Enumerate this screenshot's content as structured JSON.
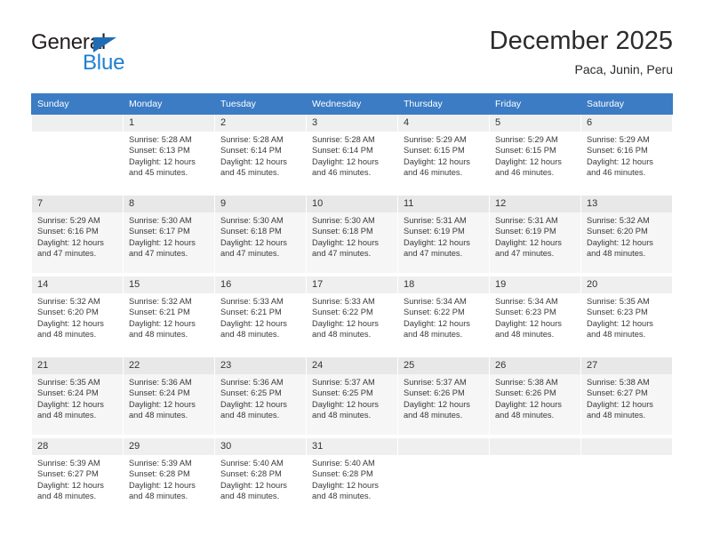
{
  "brand": {
    "name_part1": "General",
    "name_part2": "Blue",
    "triangle_color": "#1f6cb4",
    "blue_color": "#1f7fd0"
  },
  "header": {
    "title": "December 2025",
    "subtitle": "Paca, Junin, Peru"
  },
  "theme": {
    "header_bg": "#3b7cc4",
    "header_text": "#ffffff",
    "daynum_bg": "#efefef",
    "alt_row_bg": "#f6f6f6"
  },
  "weekday_headers": [
    "Sunday",
    "Monday",
    "Tuesday",
    "Wednesday",
    "Thursday",
    "Friday",
    "Saturday"
  ],
  "calendar_weeks": [
    [
      {
        "day": "",
        "sunrise": "",
        "sunset": "",
        "daylight_line1": "",
        "daylight_line2": "",
        "empty": true
      },
      {
        "day": "1",
        "sunrise": "Sunrise: 5:28 AM",
        "sunset": "Sunset: 6:13 PM",
        "daylight_line1": "Daylight: 12 hours",
        "daylight_line2": "and 45 minutes."
      },
      {
        "day": "2",
        "sunrise": "Sunrise: 5:28 AM",
        "sunset": "Sunset: 6:14 PM",
        "daylight_line1": "Daylight: 12 hours",
        "daylight_line2": "and 45 minutes."
      },
      {
        "day": "3",
        "sunrise": "Sunrise: 5:28 AM",
        "sunset": "Sunset: 6:14 PM",
        "daylight_line1": "Daylight: 12 hours",
        "daylight_line2": "and 46 minutes."
      },
      {
        "day": "4",
        "sunrise": "Sunrise: 5:29 AM",
        "sunset": "Sunset: 6:15 PM",
        "daylight_line1": "Daylight: 12 hours",
        "daylight_line2": "and 46 minutes."
      },
      {
        "day": "5",
        "sunrise": "Sunrise: 5:29 AM",
        "sunset": "Sunset: 6:15 PM",
        "daylight_line1": "Daylight: 12 hours",
        "daylight_line2": "and 46 minutes."
      },
      {
        "day": "6",
        "sunrise": "Sunrise: 5:29 AM",
        "sunset": "Sunset: 6:16 PM",
        "daylight_line1": "Daylight: 12 hours",
        "daylight_line2": "and 46 minutes."
      }
    ],
    [
      {
        "day": "7",
        "sunrise": "Sunrise: 5:29 AM",
        "sunset": "Sunset: 6:16 PM",
        "daylight_line1": "Daylight: 12 hours",
        "daylight_line2": "and 47 minutes."
      },
      {
        "day": "8",
        "sunrise": "Sunrise: 5:30 AM",
        "sunset": "Sunset: 6:17 PM",
        "daylight_line1": "Daylight: 12 hours",
        "daylight_line2": "and 47 minutes."
      },
      {
        "day": "9",
        "sunrise": "Sunrise: 5:30 AM",
        "sunset": "Sunset: 6:18 PM",
        "daylight_line1": "Daylight: 12 hours",
        "daylight_line2": "and 47 minutes."
      },
      {
        "day": "10",
        "sunrise": "Sunrise: 5:30 AM",
        "sunset": "Sunset: 6:18 PM",
        "daylight_line1": "Daylight: 12 hours",
        "daylight_line2": "and 47 minutes."
      },
      {
        "day": "11",
        "sunrise": "Sunrise: 5:31 AM",
        "sunset": "Sunset: 6:19 PM",
        "daylight_line1": "Daylight: 12 hours",
        "daylight_line2": "and 47 minutes."
      },
      {
        "day": "12",
        "sunrise": "Sunrise: 5:31 AM",
        "sunset": "Sunset: 6:19 PM",
        "daylight_line1": "Daylight: 12 hours",
        "daylight_line2": "and 47 minutes."
      },
      {
        "day": "13",
        "sunrise": "Sunrise: 5:32 AM",
        "sunset": "Sunset: 6:20 PM",
        "daylight_line1": "Daylight: 12 hours",
        "daylight_line2": "and 48 minutes."
      }
    ],
    [
      {
        "day": "14",
        "sunrise": "Sunrise: 5:32 AM",
        "sunset": "Sunset: 6:20 PM",
        "daylight_line1": "Daylight: 12 hours",
        "daylight_line2": "and 48 minutes."
      },
      {
        "day": "15",
        "sunrise": "Sunrise: 5:32 AM",
        "sunset": "Sunset: 6:21 PM",
        "daylight_line1": "Daylight: 12 hours",
        "daylight_line2": "and 48 minutes."
      },
      {
        "day": "16",
        "sunrise": "Sunrise: 5:33 AM",
        "sunset": "Sunset: 6:21 PM",
        "daylight_line1": "Daylight: 12 hours",
        "daylight_line2": "and 48 minutes."
      },
      {
        "day": "17",
        "sunrise": "Sunrise: 5:33 AM",
        "sunset": "Sunset: 6:22 PM",
        "daylight_line1": "Daylight: 12 hours",
        "daylight_line2": "and 48 minutes."
      },
      {
        "day": "18",
        "sunrise": "Sunrise: 5:34 AM",
        "sunset": "Sunset: 6:22 PM",
        "daylight_line1": "Daylight: 12 hours",
        "daylight_line2": "and 48 minutes."
      },
      {
        "day": "19",
        "sunrise": "Sunrise: 5:34 AM",
        "sunset": "Sunset: 6:23 PM",
        "daylight_line1": "Daylight: 12 hours",
        "daylight_line2": "and 48 minutes."
      },
      {
        "day": "20",
        "sunrise": "Sunrise: 5:35 AM",
        "sunset": "Sunset: 6:23 PM",
        "daylight_line1": "Daylight: 12 hours",
        "daylight_line2": "and 48 minutes."
      }
    ],
    [
      {
        "day": "21",
        "sunrise": "Sunrise: 5:35 AM",
        "sunset": "Sunset: 6:24 PM",
        "daylight_line1": "Daylight: 12 hours",
        "daylight_line2": "and 48 minutes."
      },
      {
        "day": "22",
        "sunrise": "Sunrise: 5:36 AM",
        "sunset": "Sunset: 6:24 PM",
        "daylight_line1": "Daylight: 12 hours",
        "daylight_line2": "and 48 minutes."
      },
      {
        "day": "23",
        "sunrise": "Sunrise: 5:36 AM",
        "sunset": "Sunset: 6:25 PM",
        "daylight_line1": "Daylight: 12 hours",
        "daylight_line2": "and 48 minutes."
      },
      {
        "day": "24",
        "sunrise": "Sunrise: 5:37 AM",
        "sunset": "Sunset: 6:25 PM",
        "daylight_line1": "Daylight: 12 hours",
        "daylight_line2": "and 48 minutes."
      },
      {
        "day": "25",
        "sunrise": "Sunrise: 5:37 AM",
        "sunset": "Sunset: 6:26 PM",
        "daylight_line1": "Daylight: 12 hours",
        "daylight_line2": "and 48 minutes."
      },
      {
        "day": "26",
        "sunrise": "Sunrise: 5:38 AM",
        "sunset": "Sunset: 6:26 PM",
        "daylight_line1": "Daylight: 12 hours",
        "daylight_line2": "and 48 minutes."
      },
      {
        "day": "27",
        "sunrise": "Sunrise: 5:38 AM",
        "sunset": "Sunset: 6:27 PM",
        "daylight_line1": "Daylight: 12 hours",
        "daylight_line2": "and 48 minutes."
      }
    ],
    [
      {
        "day": "28",
        "sunrise": "Sunrise: 5:39 AM",
        "sunset": "Sunset: 6:27 PM",
        "daylight_line1": "Daylight: 12 hours",
        "daylight_line2": "and 48 minutes."
      },
      {
        "day": "29",
        "sunrise": "Sunrise: 5:39 AM",
        "sunset": "Sunset: 6:28 PM",
        "daylight_line1": "Daylight: 12 hours",
        "daylight_line2": "and 48 minutes."
      },
      {
        "day": "30",
        "sunrise": "Sunrise: 5:40 AM",
        "sunset": "Sunset: 6:28 PM",
        "daylight_line1": "Daylight: 12 hours",
        "daylight_line2": "and 48 minutes."
      },
      {
        "day": "31",
        "sunrise": "Sunrise: 5:40 AM",
        "sunset": "Sunset: 6:28 PM",
        "daylight_line1": "Daylight: 12 hours",
        "daylight_line2": "and 48 minutes."
      },
      {
        "day": "",
        "sunrise": "",
        "sunset": "",
        "daylight_line1": "",
        "daylight_line2": "",
        "empty": true
      },
      {
        "day": "",
        "sunrise": "",
        "sunset": "",
        "daylight_line1": "",
        "daylight_line2": "",
        "empty": true
      },
      {
        "day": "",
        "sunrise": "",
        "sunset": "",
        "daylight_line1": "",
        "daylight_line2": "",
        "empty": true
      }
    ]
  ]
}
